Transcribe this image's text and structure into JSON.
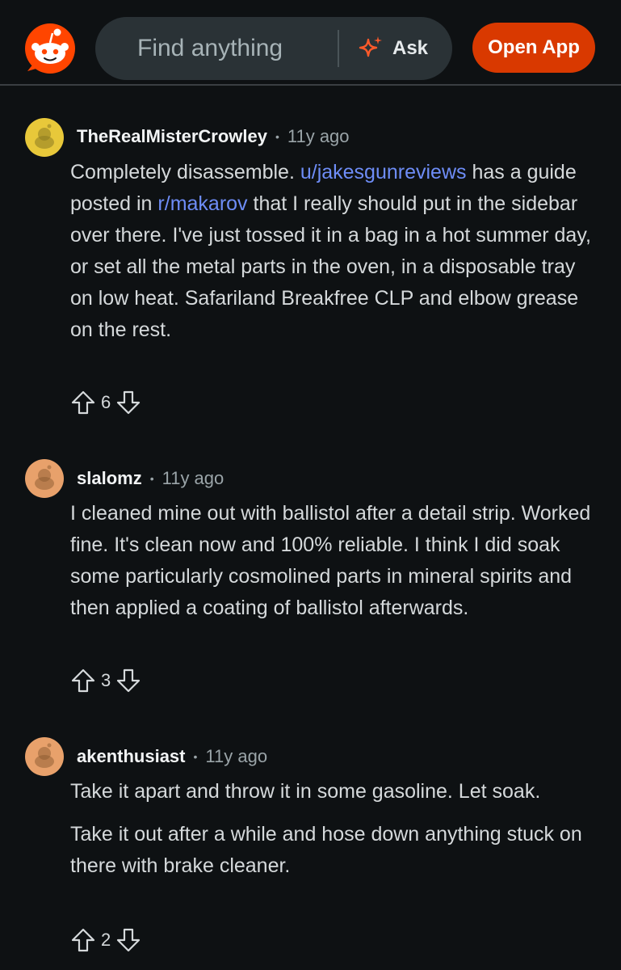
{
  "header": {
    "search_placeholder": "Find anything",
    "ask_label": "Ask",
    "open_app_label": "Open App",
    "brand_color": "#ff4500",
    "accent_button_color": "#d93900"
  },
  "comments": [
    {
      "author": "TheRealMisterCrowley",
      "separator": "•",
      "time": "11y ago",
      "avatar_color": "#e8c83a",
      "body_parts": [
        "Completely disassemble. ",
        "u/jakesgunreviews",
        " has a guide posted in ",
        "r/makarov",
        " that I really should put in the sidebar over there. I've just tossed it in a bag in a hot summer day, or set all the metal parts in the oven, in a disposable tray on low heat. Safariland Breakfree CLP and elbow grease on the rest."
      ],
      "votes": "6"
    },
    {
      "author": "slalomz",
      "separator": "•",
      "time": "11y ago",
      "avatar_color": "#e8a16b",
      "paragraphs": [
        "I cleaned mine out with ballistol after a detail strip. Worked fine. It's clean now and 100% reliable. I think I did soak some particularly cosmolined parts in mineral spirits and then applied a coating of ballistol afterwards."
      ],
      "votes": "3"
    },
    {
      "author": "akenthusiast",
      "separator": "•",
      "time": "11y ago",
      "avatar_color": "#e8a16b",
      "paragraphs": [
        "Take it apart and throw it in some gasoline. Let soak.",
        "Take it out after a while and hose down anything stuck on there with brake cleaner."
      ],
      "votes": "2"
    }
  ]
}
